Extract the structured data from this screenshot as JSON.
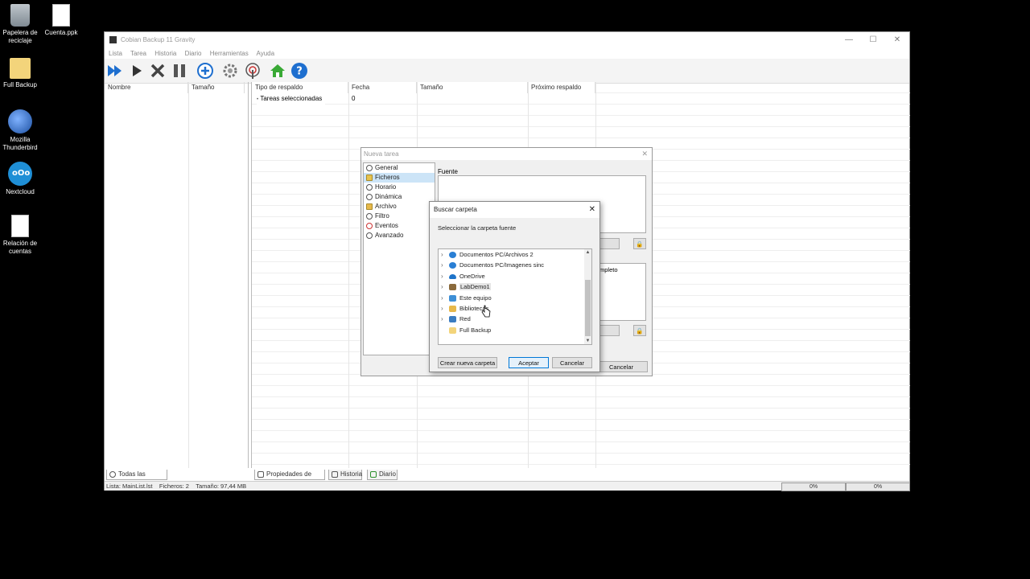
{
  "desktop": {
    "icons": [
      {
        "label": "Papelera de reciclaje",
        "icon": "recycle-bin-icon"
      },
      {
        "label": "Cuenta.ppk",
        "icon": "file-icon"
      },
      {
        "label": "Full Backup",
        "icon": "folder-icon"
      },
      {
        "label": "Mozilla Thunderbird",
        "icon": "thunderbird-icon"
      },
      {
        "label": "Nextcloud",
        "icon": "nextcloud-icon"
      },
      {
        "label": "Relación de cuentas",
        "icon": "document-icon"
      }
    ]
  },
  "window": {
    "title": "Cobian Backup 11 Gravity",
    "menu": [
      "Lista",
      "Tarea",
      "Historia",
      "Diario",
      "Herramientas",
      "Ayuda"
    ],
    "left_columns": [
      "Nombre",
      "Tamaño"
    ],
    "right_columns": [
      "Tipo de respaldo",
      "Fecha",
      "Tamaño",
      "Próximo respaldo"
    ],
    "row": {
      "label": "Tareas seleccionadas",
      "value": "0"
    },
    "left_tab": "Todas las tareas",
    "right_tabs": [
      "Propiedades de tarea",
      "Historia",
      "Diario"
    ],
    "status": {
      "list": "Lista: MainList.lst",
      "files": "Ficheros: 2",
      "size": "Tamaño: 97,44 MB",
      "progress1": "0%",
      "progress2": "0%"
    }
  },
  "nueva_tarea": {
    "title": "Nueva tarea",
    "items": [
      "General",
      "Ficheros",
      "Horario",
      "Dinámica",
      "Archivo",
      "Filtro",
      "Eventos",
      "Avanzado"
    ],
    "selected": "Ficheros",
    "fuente_label": "Fuente",
    "destino_fragment": "mpleto",
    "cancel_label": "Cancelar"
  },
  "buscar_carpeta": {
    "title": "Buscar carpeta",
    "prompt": "Seleccionar la carpeta fuente",
    "tree": [
      {
        "label": "Documentos PC/Archivos 2",
        "icon": "sync-folder-icon",
        "color": "#2a7fd4"
      },
      {
        "label": "Documentos PC/Imagenes sinc",
        "icon": "sync-folder-icon",
        "color": "#2a7fd4"
      },
      {
        "label": "OneDrive",
        "icon": "onedrive-icon",
        "color": "#1e73c9"
      },
      {
        "label": "LabDemo1",
        "icon": "user-icon",
        "color": "#8a6a3c"
      },
      {
        "label": "Este equipo",
        "icon": "computer-icon",
        "color": "#3d8fd6"
      },
      {
        "label": "Bibliotecas",
        "icon": "library-icon",
        "color": "#e7b84a"
      },
      {
        "label": "Red",
        "icon": "network-icon",
        "color": "#3a7cc0"
      },
      {
        "label": "Full Backup",
        "icon": "folder-icon",
        "color": "#f3d47b"
      }
    ],
    "new_folder_label": "Crear nueva carpeta",
    "ok_label": "Aceptar",
    "cancel_label": "Cancelar"
  }
}
